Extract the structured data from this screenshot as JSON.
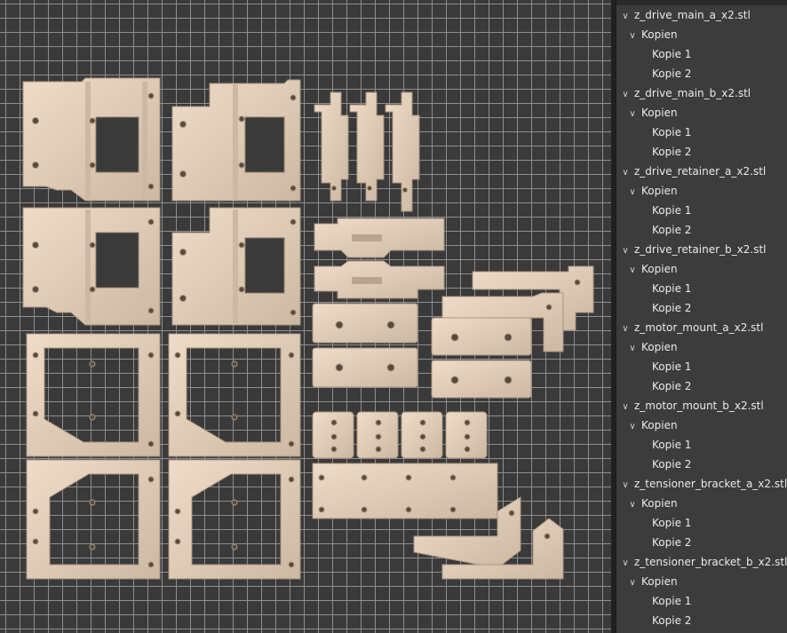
{
  "object_list": {
    "items": [
      {
        "name": "z_drive_main_a_x2.stl",
        "group": "Kopien",
        "copies": [
          "Kopie 1",
          "Kopie 2"
        ]
      },
      {
        "name": "z_drive_main_b_x2.stl",
        "group": "Kopien",
        "copies": [
          "Kopie 1",
          "Kopie 2"
        ]
      },
      {
        "name": "z_drive_retainer_a_x2.stl",
        "group": "Kopien",
        "copies": [
          "Kopie 1",
          "Kopie 2"
        ]
      },
      {
        "name": "z_drive_retainer_b_x2.stl",
        "group": "Kopien",
        "copies": [
          "Kopie 1",
          "Kopie 2"
        ]
      },
      {
        "name": "z_motor_mount_a_x2.stl",
        "group": "Kopien",
        "copies": [
          "Kopie 1",
          "Kopie 2"
        ]
      },
      {
        "name": "z_motor_mount_b_x2.stl",
        "group": "Kopien",
        "copies": [
          "Kopie 1",
          "Kopie 2"
        ]
      },
      {
        "name": "z_tensioner_bracket_a_x2.stl",
        "group": "Kopien",
        "copies": [
          "Kopie 1",
          "Kopie 2"
        ]
      },
      {
        "name": "z_tensioner_bracket_b_x2.stl",
        "group": "Kopien",
        "copies": [
          "Kopie 1",
          "Kopie 2"
        ]
      }
    ]
  },
  "colors": {
    "part": "#e6d2be",
    "part_shade": "#b8a48f",
    "part_dark": "#8c7966",
    "hole": "#5a4a3c",
    "grid_bg": "#3a3a3a",
    "grid_line": "#8e8e8e",
    "panel_bg": "#3c3c3c"
  },
  "icons": {
    "expanded": "chevron-down-icon"
  }
}
